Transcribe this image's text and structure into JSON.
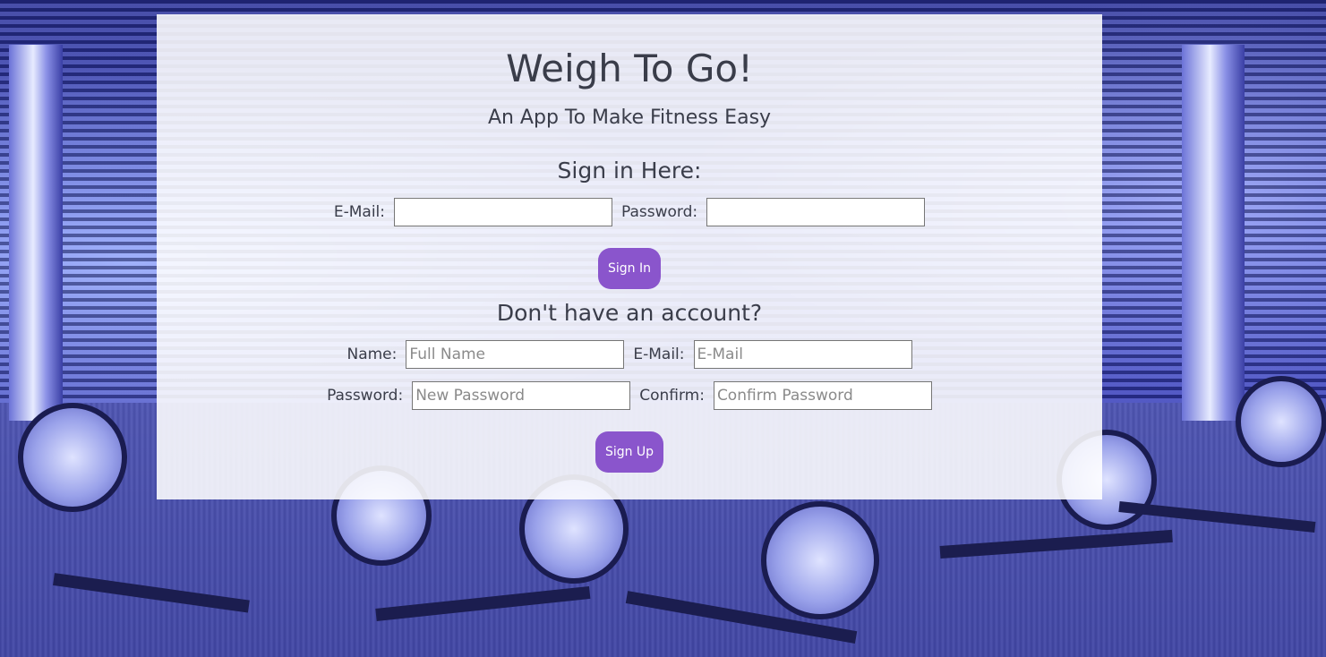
{
  "app": {
    "title": "Weigh To Go!",
    "subtitle": "An App To Make Fitness Easy"
  },
  "sign_in": {
    "heading": "Sign in Here:",
    "email_label": "E-Mail:",
    "email_value": "",
    "email_placeholder": "",
    "password_label": "Password:",
    "password_value": "",
    "password_placeholder": "",
    "button_label": "Sign In"
  },
  "sign_up": {
    "heading": "Don't have an account?",
    "name_label": "Name:",
    "name_placeholder": "Full Name",
    "email_label": "E-Mail:",
    "email_placeholder": "E-Mail",
    "password_label": "Password:",
    "password_placeholder": "New Password",
    "confirm_label": "Confirm:",
    "confirm_placeholder": "Confirm Password",
    "button_label": "Sign Up"
  },
  "colors": {
    "accent": "#8a55cc",
    "panel_background": "rgba(255,255,255,0.88)",
    "text": "#3a3d4a"
  },
  "background": {
    "icon": "gym-spin-bikes-photo"
  }
}
